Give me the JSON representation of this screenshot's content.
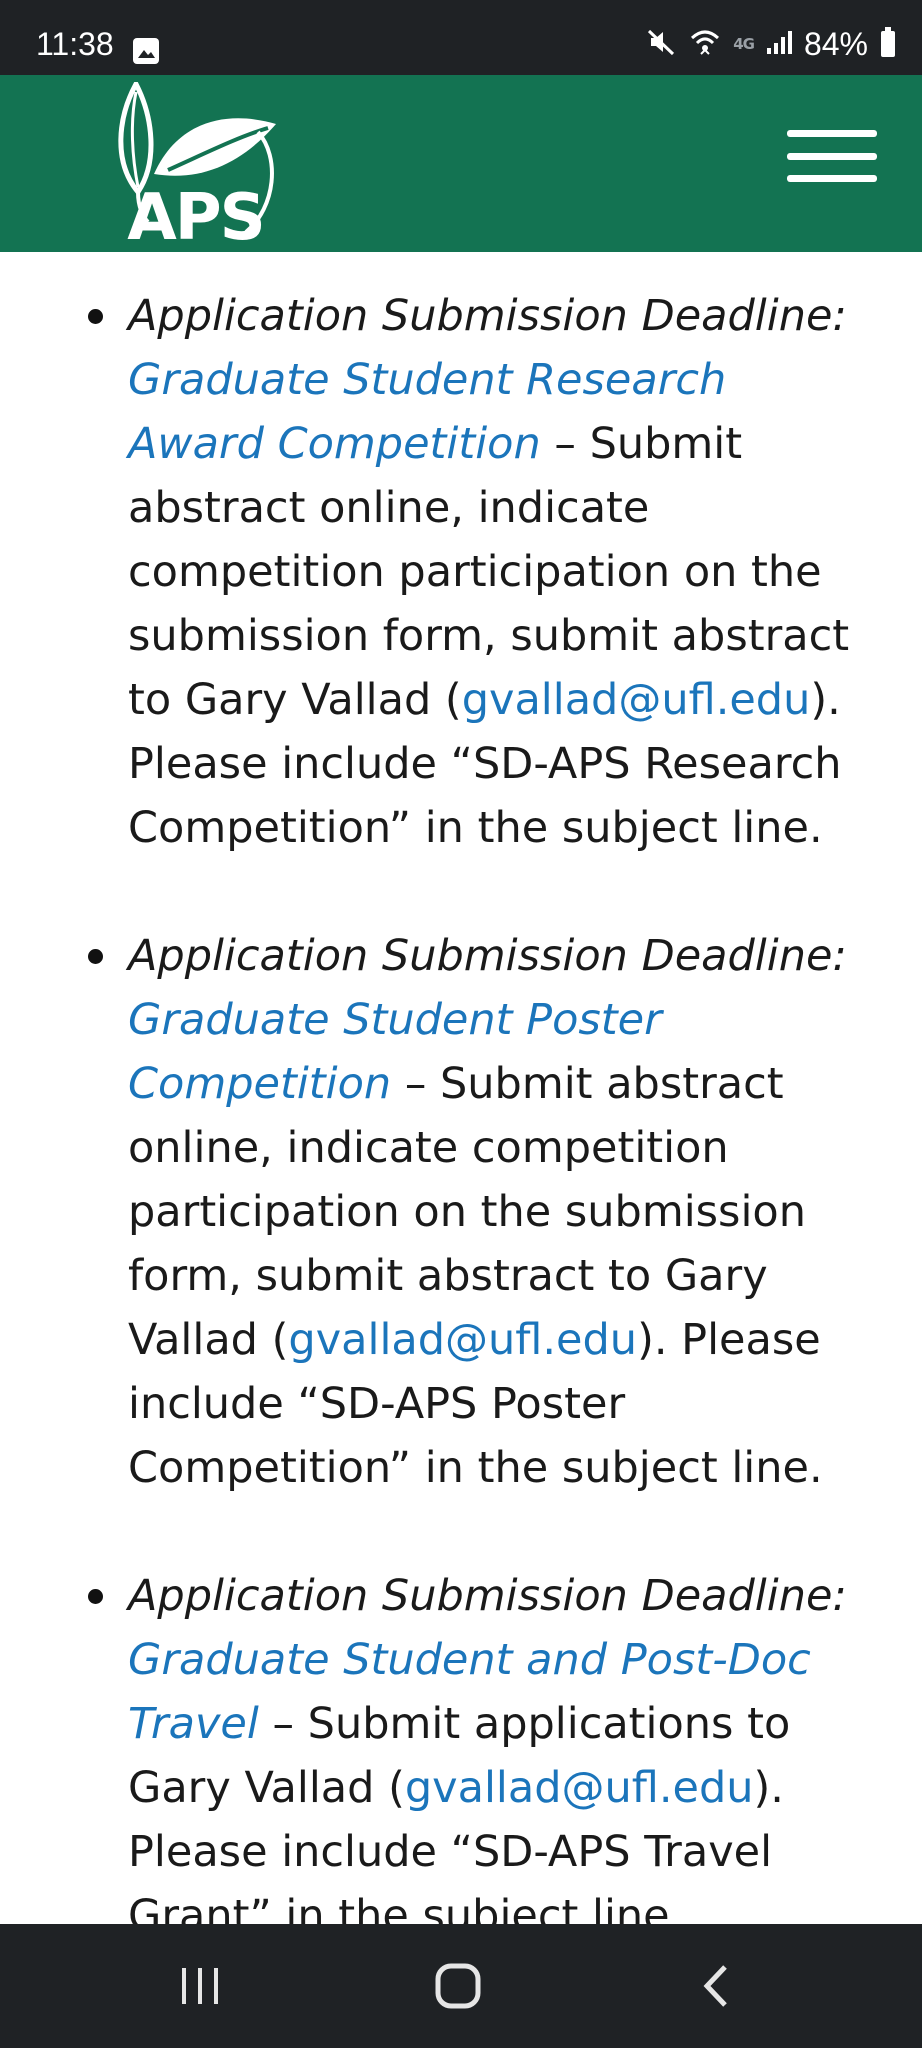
{
  "status_bar": {
    "time": "11:38",
    "network_label": "4G",
    "battery_percent": "84%",
    "icons": [
      "image-icon",
      "mute-icon",
      "wifi-icon",
      "signal-icon",
      "battery-icon"
    ]
  },
  "header": {
    "logo_text": "APS",
    "brand_color": "#137352",
    "menu_icon": "hamburger-icon"
  },
  "items": [
    {
      "label": "Application Submission Deadline:",
      "link": "Graduate Student Research Award Competition",
      "text_1": " – Submit abstract online, indicate competition participation on the submission form, submit abstract to Gary Vallad (",
      "email": "gvallad@ufl.edu",
      "text_2": "). Please include “SD-APS Research Competition” in the subject line."
    },
    {
      "label": "Application Submission Deadline:",
      "link": "Graduate Student Poster Competition",
      "text_1": " – Submit abstract online, indicate competition participation on the submission form, submit abstract to Gary Vallad (",
      "email": "gvallad@ufl.edu",
      "text_2": "). Please include “SD-APS Poster Competition” in the subject line."
    },
    {
      "label": "Application Submission Deadline:",
      "link": "Graduate Student and Post-Doc Travel",
      "text_1": " – Submit applications to Gary Vallad (",
      "email": "gvallad@ufl.edu",
      "text_2": "). Please include “SD-APS Travel Grant” in the subject line."
    }
  ],
  "nav_bar": {
    "icons": [
      "recent-apps-icon",
      "home-icon",
      "back-icon"
    ]
  }
}
